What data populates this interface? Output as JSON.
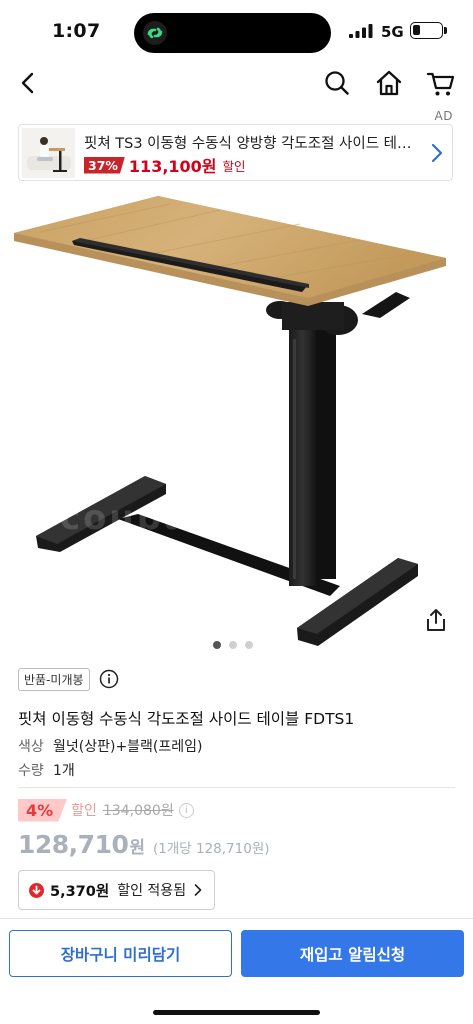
{
  "status_bar": {
    "time": "1:07",
    "network": "5G"
  },
  "nav": {
    "back_icon": "chevron-left-icon",
    "search_icon": "search-icon",
    "home_icon": "home-icon",
    "cart_icon": "cart-icon"
  },
  "ad": {
    "label": "AD",
    "title": "핏쳐 TS3 이동형 수동식 양방향 각도조절 사이드 테이...",
    "discount_badge": "37%",
    "price": "113,100원",
    "sale_label": "할인"
  },
  "gallery": {
    "watermark": "coupang",
    "dots": [
      {
        "active": true
      },
      {
        "active": false
      },
      {
        "active": false
      }
    ],
    "share_icon": "share-icon"
  },
  "product": {
    "tag": "반품-미개봉",
    "title": "핏쳐 이동형 수동식 각도조절 사이드 테이블 FDTS1",
    "options": [
      {
        "key": "색상",
        "value": "월넛(상판)+블랙(프레임)"
      },
      {
        "key": "수량",
        "value": "1개"
      }
    ]
  },
  "pricing": {
    "discount_badge": "4%",
    "discount_label": "할인",
    "original_price": "134,080원",
    "price": "128,710",
    "price_unit": "원",
    "unit_price": "(1개당 128,710원)",
    "coupon_amount": "5,370원",
    "coupon_text": "할인 적용됨"
  },
  "actions": {
    "cart_label": "장바구니 미리담기",
    "restock_label": "재입고 알림신청"
  },
  "colors": {
    "accent_blue": "#3477e8",
    "sale_red": "#d0021b",
    "price_gray": "#aab0bc",
    "discount_pink": "#ffc9c9"
  }
}
